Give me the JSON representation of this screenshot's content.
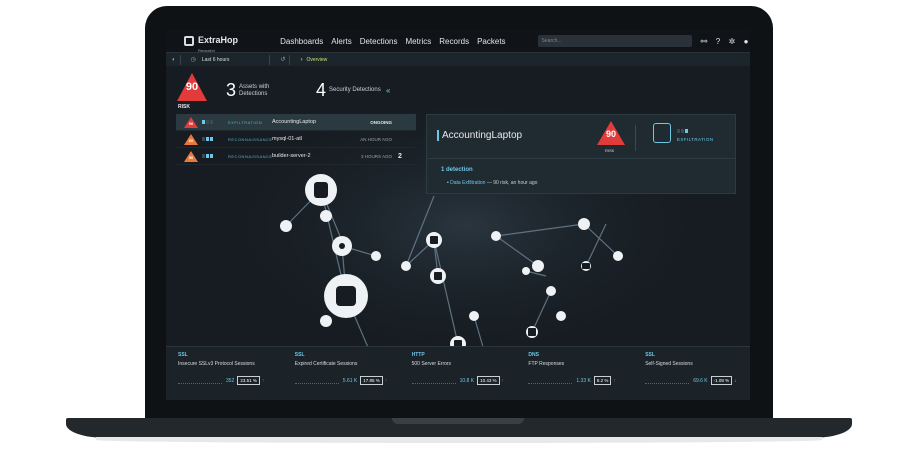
{
  "app": {
    "logo_text": "ExtraHop",
    "logo_sub": "Reveal(x)",
    "nav": [
      "Dashboards",
      "Alerts",
      "Detections",
      "Metrics",
      "Records",
      "Packets"
    ],
    "search_placeholder": "Search..."
  },
  "timebar": {
    "time_range": "Last 6 hours",
    "view": "Overview"
  },
  "summary": {
    "risk_score": "90",
    "risk_label": "RISK",
    "assets_count": "3",
    "assets_label": "Assets with Detections",
    "security_count": "4",
    "security_label": "Security Detections",
    "collapse_icon": "«"
  },
  "detections": [
    {
      "risk": "90",
      "bars": 1,
      "category": "EXFILTRATION",
      "device": "AccountingLaptop",
      "when": "ONGOING",
      "selected": true,
      "extra": ""
    },
    {
      "risk": "60",
      "bars": 2,
      "category": "RECONNAISSANCE",
      "device": "mysql-01-atl",
      "when": "AN HOUR AGO",
      "selected": false,
      "extra": ""
    },
    {
      "risk": "50",
      "bars": 2,
      "category": "RECONNAISSANCE",
      "device": "builder-server-2",
      "when": "3 HOURS AGO",
      "selected": false,
      "extra": "2"
    }
  ],
  "panel": {
    "device": "AccountingLaptop",
    "risk": "90",
    "risk_label": "RISK",
    "category": "EXFILTRATION",
    "detection_count": "1 detection",
    "detection_link": "Data Exfiltration",
    "detection_detail": " — 90 risk, an hour ago"
  },
  "metrics": [
    {
      "protocol": "SSL",
      "name": "Insecure SSLv3 Protocol Sessions",
      "value": "352",
      "pct": "23.51 %",
      "dir": "up"
    },
    {
      "protocol": "SSL",
      "name": "Expired Certificate Sessions",
      "value": "5.61 K",
      "pct": "17.85 %",
      "dir": "up"
    },
    {
      "protocol": "HTTP",
      "name": "500 Server Errors",
      "value": "10.8 K",
      "pct": "10.43 %",
      "dir": "up"
    },
    {
      "protocol": "DNS",
      "name": "FTP Responses",
      "value": "1.33 K",
      "pct": "8.2 %",
      "dir": "up"
    },
    {
      "protocol": "SSL",
      "name": "Self-Signed Sessions",
      "value": "69.6 K",
      "pct": "-1.08 %",
      "dir": "down"
    }
  ],
  "colors": {
    "accent": "#6fc6e6",
    "risk_red": "#e23b3b",
    "risk_orange": "#e8793a",
    "overview": "#c7e07a"
  },
  "icons": {
    "network": "network-icon",
    "help": "help-icon",
    "settings": "gear-icon",
    "user": "user-icon"
  }
}
